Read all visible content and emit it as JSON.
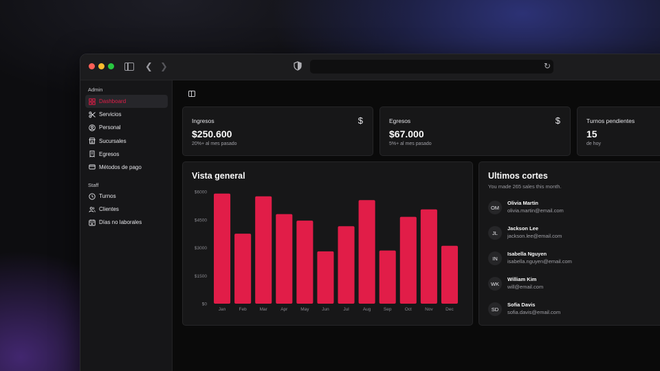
{
  "sidebar": {
    "sections": [
      {
        "label": "Admin",
        "items": [
          {
            "label": "Dashboard",
            "icon": "dashboard-icon",
            "active": true
          },
          {
            "label": "Servicios",
            "icon": "scissors-icon"
          },
          {
            "label": "Personal",
            "icon": "user-circle-icon"
          },
          {
            "label": "Sucursales",
            "icon": "store-icon"
          },
          {
            "label": "Egresos",
            "icon": "receipt-icon"
          },
          {
            "label": "Métodos de pago",
            "icon": "credit-card-icon"
          }
        ]
      },
      {
        "label": "Staff",
        "items": [
          {
            "label": "Turnos",
            "icon": "clock-icon"
          },
          {
            "label": "Clientes",
            "icon": "users-icon"
          },
          {
            "label": "Días no laborales",
            "icon": "calendar-off-icon"
          }
        ]
      }
    ]
  },
  "stats": [
    {
      "title": "Ingresos",
      "value": "$250.600",
      "sub": "20%+ al mes pasado",
      "icon": "dollar-icon"
    },
    {
      "title": "Egresos",
      "value": "$67.000",
      "sub": "5%+ al mes pasado",
      "icon": "dollar-icon"
    },
    {
      "title": "Turnos pendientes",
      "value": "15",
      "sub": "de hoy"
    }
  ],
  "overview": {
    "title": "Vista general"
  },
  "chart_data": {
    "type": "bar",
    "categories": [
      "Jan",
      "Feb",
      "Mar",
      "Apr",
      "May",
      "Jun",
      "Jul",
      "Aug",
      "Sep",
      "Oct",
      "Nov",
      "Dec"
    ],
    "values": [
      5900,
      3750,
      5750,
      4800,
      4450,
      2800,
      4150,
      5550,
      2850,
      4650,
      5050,
      3100
    ],
    "ytick_labels": [
      "$0",
      "$1500",
      "$3000",
      "$4500",
      "$6000"
    ],
    "ylim": [
      0,
      6000
    ],
    "color": "#e11d48",
    "grid": false
  },
  "recent": {
    "title": "Ultimos cortes",
    "subtitle": "You made 265 sales this month.",
    "sales": [
      {
        "initials": "OM",
        "name": "Olivia Martin",
        "email": "olivia.martin@email.com"
      },
      {
        "initials": "JL",
        "name": "Jackson Lee",
        "email": "jackson.lee@email.com"
      },
      {
        "initials": "IN",
        "name": "Isabella Nguyen",
        "email": "isabella.nguyen@email.com"
      },
      {
        "initials": "WK",
        "name": "William Kim",
        "email": "will@email.com"
      },
      {
        "initials": "SD",
        "name": "Sofia Davis",
        "email": "sofia.davis@email.com"
      }
    ]
  }
}
